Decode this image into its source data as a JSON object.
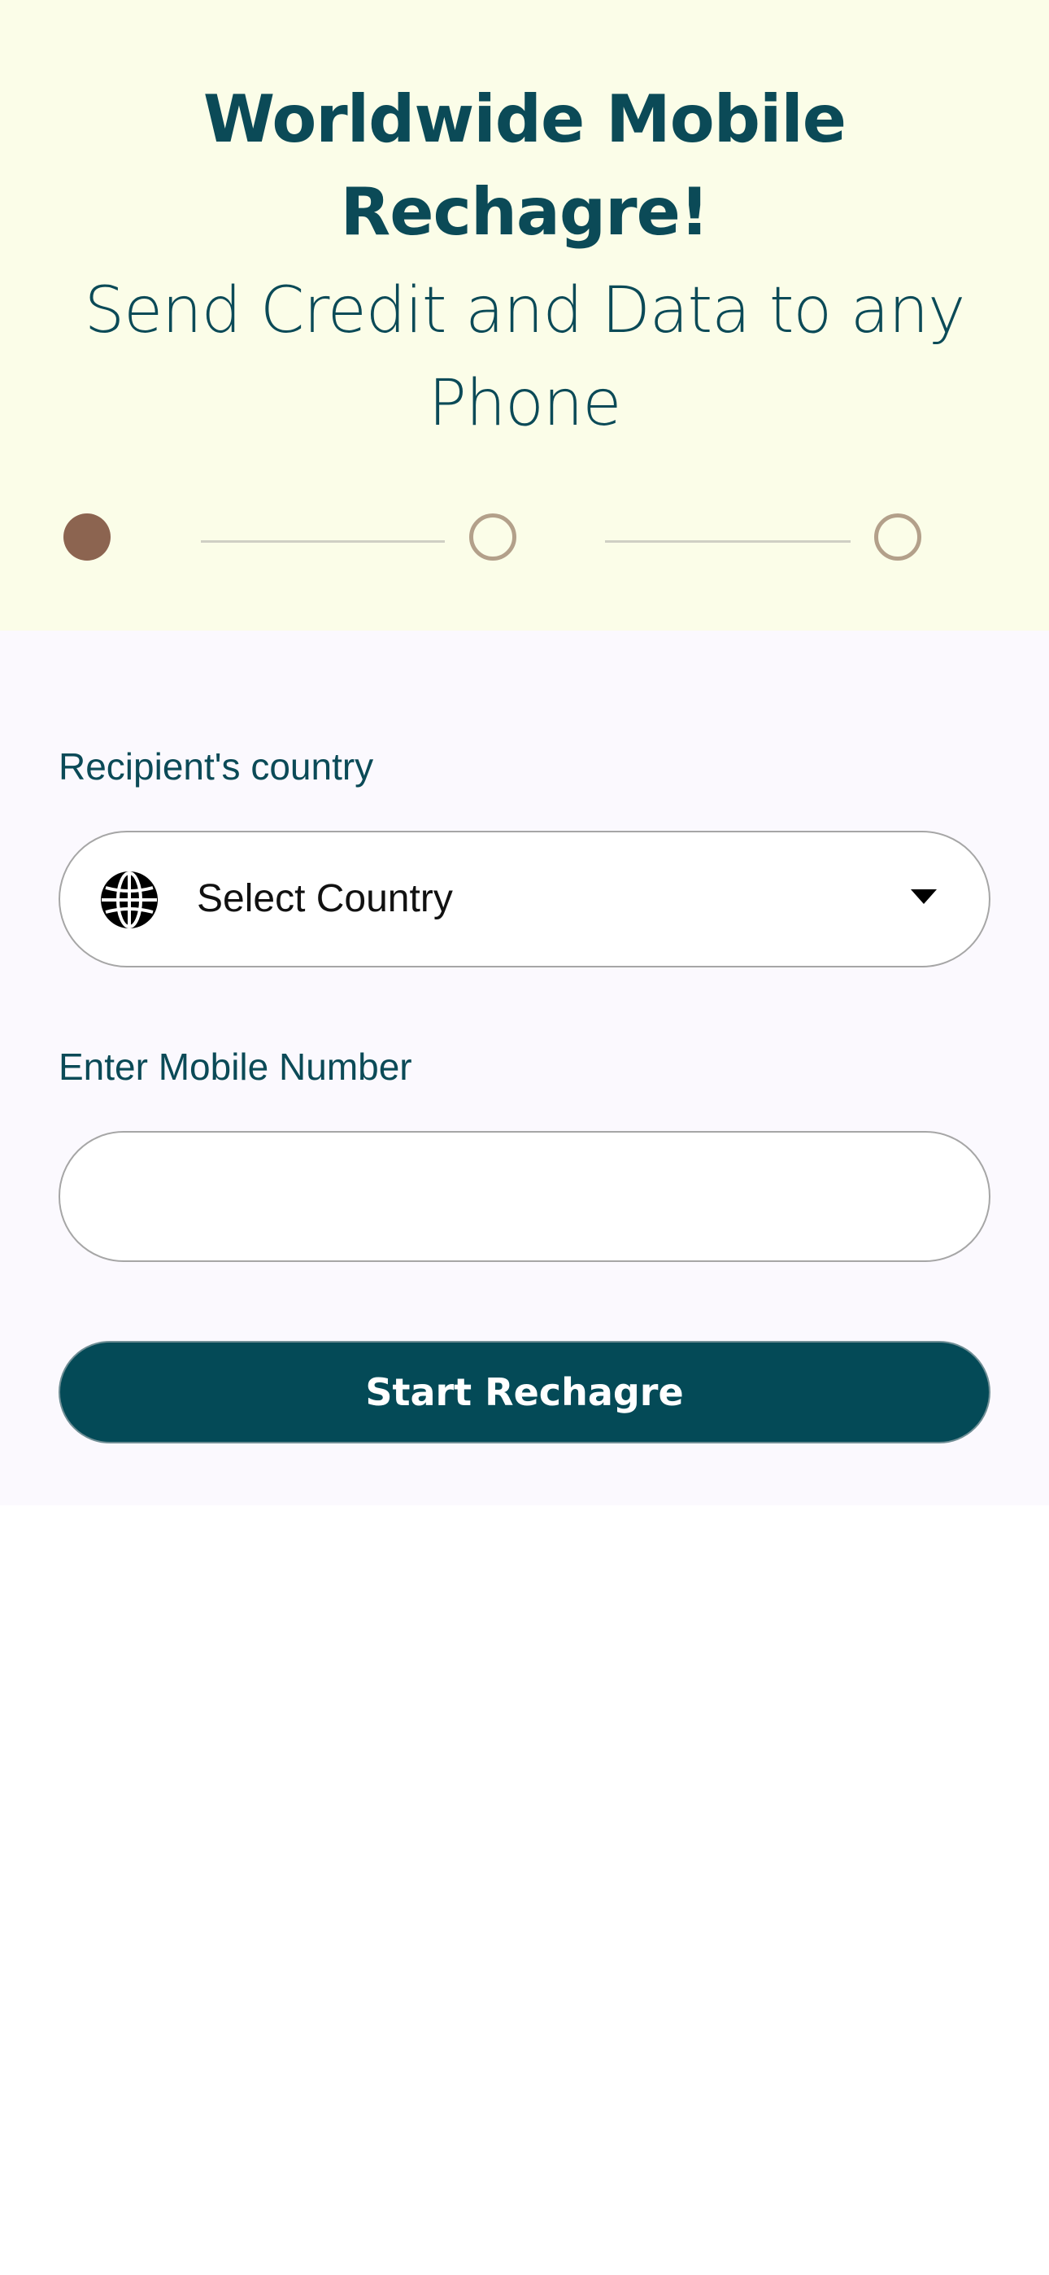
{
  "hero": {
    "title_line1": "Worldwide Mobile",
    "title_line2": "Rechagre!",
    "subtitle_line1": "Send Credit and Data to any",
    "subtitle_line2": "Phone",
    "background": "#fbfde8",
    "text_color": "#0b4a57"
  },
  "stepper": {
    "total_steps": 3,
    "current_step": 1,
    "active_color": "#8c6450",
    "inactive_color": "#b3a08a"
  },
  "form": {
    "country_label": "Recipient's country",
    "country_select": {
      "value": "Select Country",
      "icon": "globe-icon",
      "dropdown_icon": "caret-down-icon"
    },
    "mobile_label": "Enter Mobile Number",
    "mobile_input": {
      "value": "",
      "placeholder": ""
    },
    "submit_label": "Start Rechagre",
    "button_color": "#044a57"
  }
}
